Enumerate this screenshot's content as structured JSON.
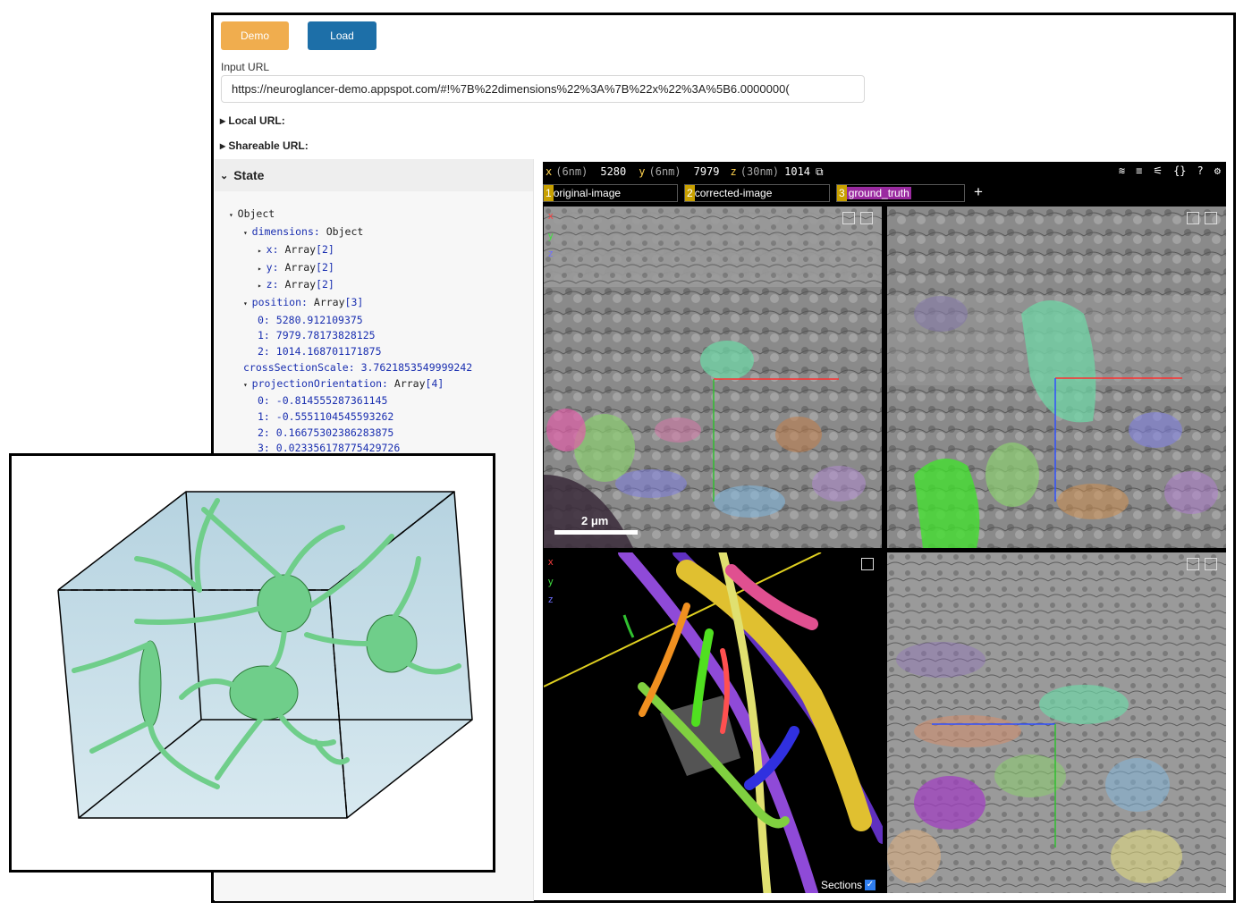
{
  "buttons": {
    "demo": "Demo",
    "load": "Load"
  },
  "input_url": {
    "label": "Input URL",
    "value": "https://neuroglancer-demo.appspot.com/#!%7B%22dimensions%22%3A%7B%22x%22%3A%5B6.0000000("
  },
  "local_url": "Local URL:",
  "shareable_url": "Shareable URL:",
  "state": {
    "title": "State",
    "tree": {
      "root": "Object",
      "dimensions_key": "dimensions:",
      "dimensions_type": "Object",
      "x_key": "x:",
      "y_key": "y:",
      "z_key": "z:",
      "array_type": "Array",
      "array2": "[2]",
      "position_key": "position:",
      "array3": "[3]",
      "pos0_idx": "0:",
      "pos0": "5280.912109375",
      "pos1_idx": "1:",
      "pos1": "7979.78173828125",
      "pos2_idx": "2:",
      "pos2": "1014.168701171875",
      "cross_key": "crossSectionScale:",
      "cross_val": "3.7621853549999242",
      "proj_key": "projectionOrientation:",
      "array4": "[4]",
      "po0_idx": "0:",
      "po0": "-0.814555287361145",
      "po1_idx": "1:",
      "po1": "-0.5551104545593262",
      "po2_idx": "2:",
      "po2": "0.16675302386283875",
      "po3_idx": "3:",
      "po3": "0.023356178775429726"
    }
  },
  "viewer": {
    "x_label": "x",
    "x_unit": "(6nm)",
    "x_val": "5280",
    "y_label": "y",
    "y_unit": "(6nm)",
    "y_val": "7979",
    "z_label": "z",
    "z_unit": "(30nm)",
    "z_val": "1014",
    "layers": [
      {
        "num": "1",
        "name": "original-image",
        "color": "#c8a000"
      },
      {
        "num": "2",
        "name": "corrected-image",
        "color": "#c8a000"
      },
      {
        "num": "3",
        "name": "ground_truth",
        "color": "#a000a0"
      }
    ],
    "add_layer": "+",
    "scale_bar": "2 μm",
    "axis_x": "x",
    "axis_y": "y",
    "axis_z": "z",
    "sections_label": "Sections",
    "toolbar_icons": [
      "layers-icon",
      "list-icon",
      "sliders-icon",
      "braces-icon",
      "help-icon",
      "settings-icon"
    ],
    "toolbar_glyphs": [
      "≋",
      "≡",
      "⚟",
      "{}",
      "?",
      "⚙"
    ]
  }
}
